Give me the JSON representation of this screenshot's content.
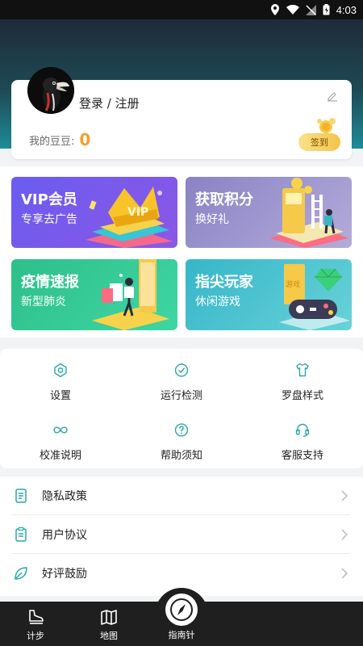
{
  "status_bar": {
    "time": "4:03"
  },
  "profile": {
    "login_label": "登录 / 注册",
    "beans_label": "我的豆豆:",
    "beans_value": "0",
    "checkin_label": "签到"
  },
  "promos": [
    {
      "title": "VIP会员",
      "subtitle": "专享去广告",
      "art_text": "VIP"
    },
    {
      "title": "获取积分",
      "subtitle": "换好礼"
    },
    {
      "title": "疫情速报",
      "subtitle": "新型肺炎"
    },
    {
      "title": "指尖玩家",
      "subtitle": "休闲游戏",
      "art_text": "游戏"
    }
  ],
  "grid": [
    {
      "label": "设置",
      "icon": "settings-icon"
    },
    {
      "label": "运行检测",
      "icon": "clock-check-icon"
    },
    {
      "label": "罗盘样式",
      "icon": "shirt-icon"
    },
    {
      "label": "校准说明",
      "icon": "infinity-icon"
    },
    {
      "label": "帮助须知",
      "icon": "question-icon"
    },
    {
      "label": "客服支持",
      "icon": "headset-icon"
    }
  ],
  "list": [
    {
      "label": "隐私政策",
      "icon": "document-icon"
    },
    {
      "label": "用户协议",
      "icon": "clipboard-icon"
    },
    {
      "label": "好评鼓励",
      "icon": "leaf-icon"
    }
  ],
  "bottom_nav": [
    {
      "label": "计步",
      "icon": "shoe-icon"
    },
    {
      "label": "地图",
      "icon": "map-icon"
    },
    {
      "label": "指南针",
      "icon": "compass-icon"
    }
  ],
  "colors": {
    "accent": "#1d8c9a",
    "beans_value": "#f0a030",
    "icon_teal": "#2aa7a7"
  }
}
